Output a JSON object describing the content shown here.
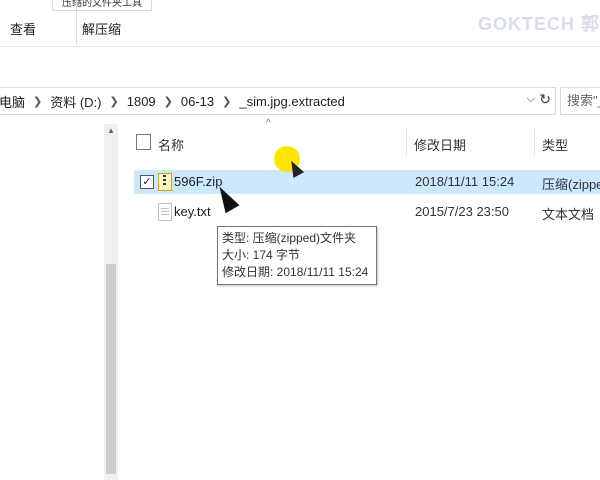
{
  "ribbon": {
    "top_tab_label": "压缩的文件夹工具",
    "tabs": [
      "查看",
      "解压缩"
    ]
  },
  "watermark": "GOKTECH 郭",
  "address_bar": {
    "crumbs": [
      "电脑",
      "资料 (D:)",
      "1809",
      "06-13",
      "_sim.jpg.extracted"
    ],
    "dropdown_icon": "chevron-down-icon",
    "refresh_icon": "refresh-icon"
  },
  "search": {
    "placeholder": "搜索\"_s"
  },
  "columns": {
    "name": "名称",
    "date_modified": "修改日期",
    "type": "类型"
  },
  "files": [
    {
      "name": "596F.zip",
      "date": "2018/11/11 15:24",
      "type": "压缩(zipped)",
      "icon": "zip-folder-icon",
      "selected": true,
      "checked": "✓"
    },
    {
      "name": "key.txt",
      "date": "2015/7/23 23:50",
      "type": "文本文档",
      "icon": "text-file-icon",
      "selected": false,
      "checked": ""
    }
  ],
  "tooltip": {
    "type_line": "类型: 压缩(zipped)文件夹",
    "size_line": "大小: 174 字节",
    "date_line": "修改日期: 2018/11/11 15:24"
  },
  "colors": {
    "selected_row": "#cce8ff",
    "cursor_highlight": "#ffe400"
  }
}
